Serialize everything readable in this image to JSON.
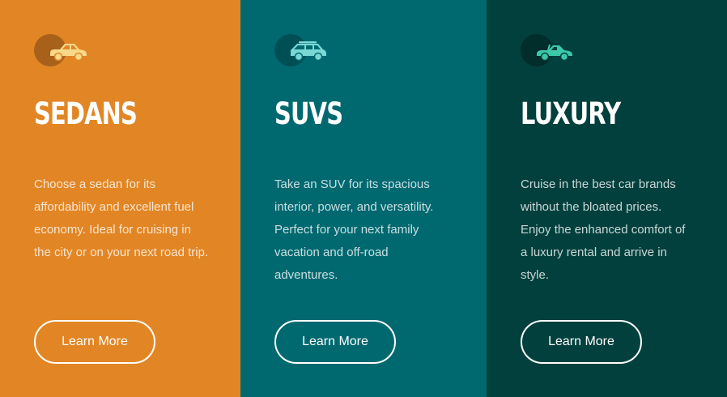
{
  "colors": {
    "sedans_bg": "#e28625",
    "suvs_bg": "#006970",
    "luxury_bg": "#02403d",
    "sedans_icon": "#f9d88a",
    "suvs_icon": "#79d8d4",
    "luxury_icon": "#3bc8a8",
    "button_border": "#ffffff"
  },
  "cards": [
    {
      "icon": "sedan-icon",
      "title": "SEDANS",
      "description": "Choose a sedan for its affordability and excellent fuel economy. Ideal for cruising in the city or on your next road trip.",
      "button_label": "Learn More"
    },
    {
      "icon": "suv-icon",
      "title": "SUVS",
      "description": "Take an SUV for its spacious interior, power, and versatility. Perfect for your next family vacation and off-road adventures.",
      "button_label": "Learn More"
    },
    {
      "icon": "luxury-car-icon",
      "title": "LUXURY",
      "description": "Cruise in the best car brands without the bloated prices. Enjoy the enhanced comfort of a luxury rental and arrive in style.",
      "button_label": "Learn More"
    }
  ]
}
